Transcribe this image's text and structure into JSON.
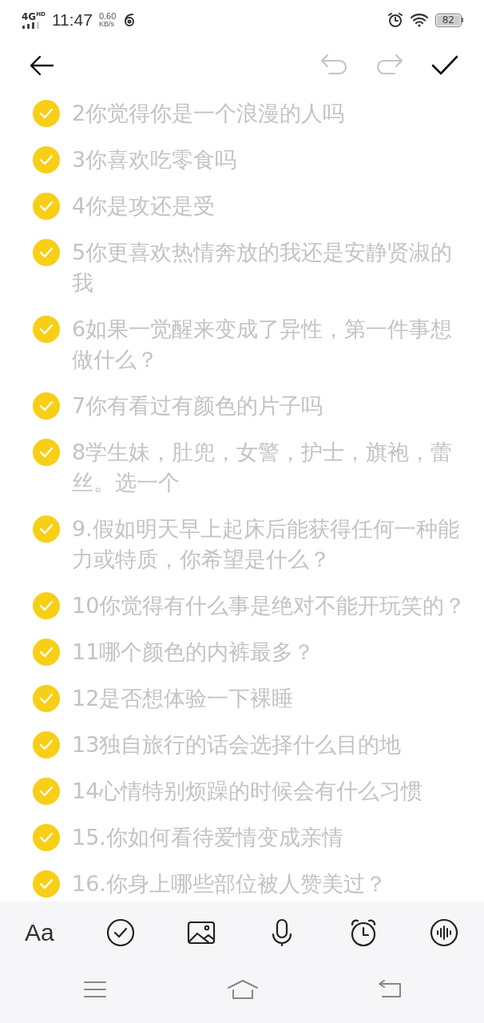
{
  "status_bar": {
    "network": "4G",
    "network_badge": "HD",
    "time": "11:47",
    "speed_value": "0.60",
    "speed_unit": "KB/s",
    "battery": "82"
  },
  "toolbar": {
    "undo_disabled": true,
    "redo_disabled": true
  },
  "checklist": [
    {
      "text": "2你觉得你是一个浪漫的人吗",
      "checked": true
    },
    {
      "text": "3你喜欢吃零食吗",
      "checked": true
    },
    {
      "text": "4你是攻还是受",
      "checked": true
    },
    {
      "text": "5你更喜欢热情奔放的我还是安静贤淑的我",
      "checked": true
    },
    {
      "text": "6如果一觉醒来变成了异性，第一件事想做什么？",
      "checked": true
    },
    {
      "text": "7你有看过有颜色的片子吗",
      "checked": true
    },
    {
      "text": "8学生妹，肚兜，女警，护士，旗袍，蕾丝。选一个",
      "checked": true
    },
    {
      "text": "9.假如明天早上起床后能获得任何一种能力或特质，你希望是什么？",
      "checked": true
    },
    {
      "text": "10你觉得有什么事是绝对不能开玩笑的？",
      "checked": true
    },
    {
      "text": "11哪个颜色的内裤最多？",
      "checked": true
    },
    {
      "text": "12是否想体验一下裸睡",
      "checked": true
    },
    {
      "text": "13独自旅行的话会选择什么目的地",
      "checked": true
    },
    {
      "text": "14心情特别烦躁的时候会有什么习惯",
      "checked": true
    },
    {
      "text": "15.你如何看待爱情变成亲情",
      "checked": true
    },
    {
      "text": "16.你身上哪些部位被人赞美过？",
      "checked": true
    }
  ],
  "format_bar": {
    "font_button": "Aa"
  }
}
